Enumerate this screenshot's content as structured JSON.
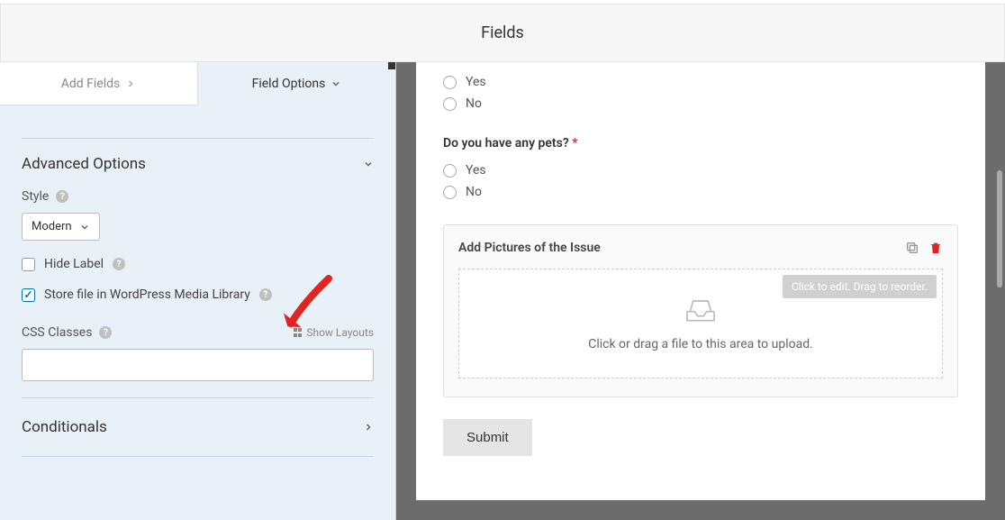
{
  "header": {
    "title": "Fields"
  },
  "sidebar": {
    "tabs": {
      "add_fields": "Add Fields",
      "field_options": "Field Options"
    },
    "advanced": {
      "title": "Advanced Options",
      "style_label": "Style",
      "style_value": "Modern",
      "hide_label": "Hide Label",
      "store_media": "Store file in WordPress Media Library",
      "css_classes": "CSS Classes",
      "show_layouts": "Show Layouts"
    },
    "conditionals": {
      "title": "Conditionals"
    }
  },
  "form": {
    "q1": {
      "options": [
        "Yes",
        "No"
      ]
    },
    "q2": {
      "label": "Do you have any pets?",
      "options": [
        "Yes",
        "No"
      ]
    },
    "upload": {
      "title": "Add Pictures of the Issue",
      "hint": "Click to edit. Drag to reorder.",
      "dropzone": "Click or drag a file to this area to upload."
    },
    "submit": "Submit"
  }
}
